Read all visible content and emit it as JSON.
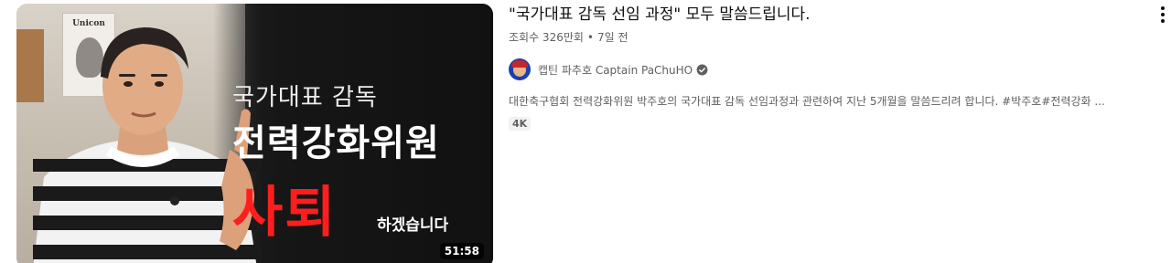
{
  "thumbnail": {
    "line1": "국가대표 감독",
    "line2": "전력강화위원",
    "line3": "사퇴",
    "line4": "하겠습니다",
    "poster_title": "Unicon",
    "duration": "51:58",
    "accent_color": "#ff1e1e"
  },
  "video": {
    "title": "\"국가대표 감독 선임 과정\" 모두 말씀드립니다.",
    "views": "조회수 326만회",
    "separator": "•",
    "age": "7일 전"
  },
  "channel": {
    "name": "캡틴 파추호 Captain PaChuHO",
    "verified_icon": "verified-check-icon",
    "avatar_icon": "channel-avatar"
  },
  "description": "대한축구협회 전력강화위원 박주호의 국가대표 감독 선임과정과 관련하여 지난 5개월을 말씀드리려 합니다. #박주호#전력강화 ...",
  "badges": [
    "4K"
  ],
  "menu_icon": "more-vert-icon"
}
